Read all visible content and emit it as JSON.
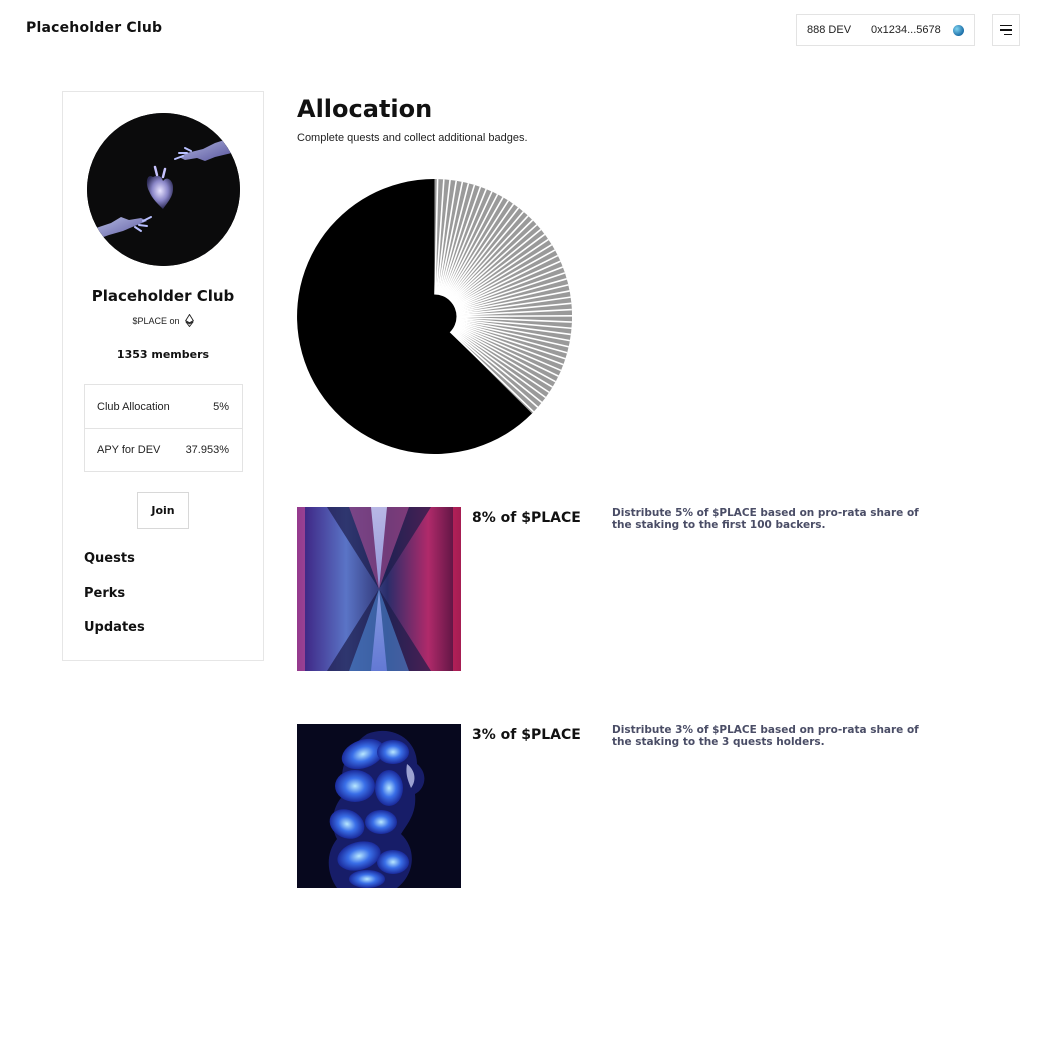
{
  "header": {
    "brand": "Placeholder Club",
    "wallet_balance": "888 DEV",
    "wallet_address": "0x1234...5678"
  },
  "sidebar": {
    "club_name": "Placeholder Club",
    "token_label": "$PLACE on",
    "members": "1353 members",
    "stats": [
      {
        "label": "Club Allocation",
        "value": "5%"
      },
      {
        "label": "APY for DEV",
        "value": "37.953%"
      }
    ],
    "join_label": "Join",
    "nav": [
      "Quests",
      "Perks",
      "Updates"
    ]
  },
  "main": {
    "title": "Allocation",
    "subtitle": "Complete quests and collect additional badges."
  },
  "rewards": [
    {
      "percent": "8% of $PLACE",
      "description": "Distribute 5% of $PLACE based on pro-rata share of the staking to the first 100 backers."
    },
    {
      "percent": "3% of $PLACE",
      "description": "Distribute 3% of $PLACE based on pro-rata share of the staking to the 3 quests holders."
    }
  ],
  "colors": {
    "pie_main": "#000000",
    "pie_stripes": "#9a9a9a",
    "description_text": "#4a4d66"
  },
  "icons": {
    "token_chain": "ethereum-icon",
    "menu": "hamburger-menu-icon",
    "wallet_avatar": "wallet-avatar-icon"
  }
}
